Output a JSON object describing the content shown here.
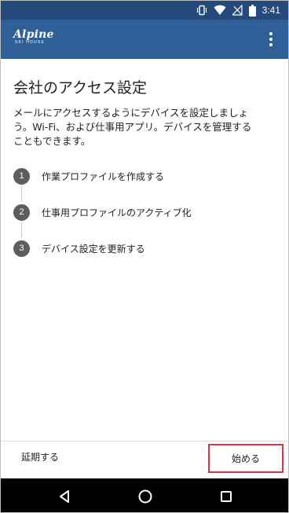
{
  "status_bar": {
    "time": "3:41",
    "icons": [
      "vibrate-icon",
      "wifi-icon",
      "battery-icon"
    ]
  },
  "app_bar": {
    "logo_main": "Alpine",
    "logo_sub": "SKI HOUSE",
    "menu_icon": "more-vert-icon"
  },
  "main": {
    "title": "会社のアクセス設定",
    "description": "メールにアクセスするようにデバイスを設定しましょう。Wi-Fi、および仕事用アプリ。デバイスを管理することもできます。",
    "steps": [
      {
        "number": "1",
        "label": "作業プロファイルを作成する"
      },
      {
        "number": "2",
        "label": "仕事用プロファイルのアクティブ化"
      },
      {
        "number": "3",
        "label": "デバイス設定を更新する"
      }
    ]
  },
  "actions": {
    "postpone_label": "延期する",
    "start_label": "始める"
  },
  "nav_bar": {
    "icons": [
      "back-icon",
      "home-icon",
      "recents-icon"
    ]
  },
  "colors": {
    "status_bar": "#234a7a",
    "app_bar": "#2f5f97",
    "highlight": "#e0333f",
    "step_circle": "#5d5d5d"
  }
}
